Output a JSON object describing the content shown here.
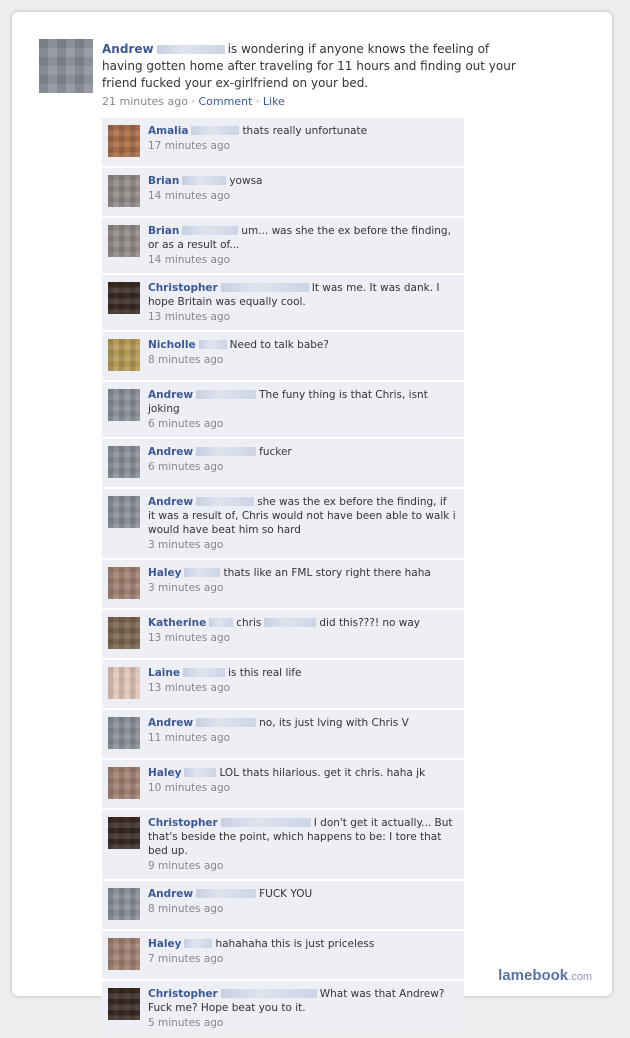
{
  "post": {
    "author": "Andrew",
    "text": "is wondering if anyone knows the feeling of having gotten home after traveling for 11 hours and finding out your friend fucked your ex-girlfriend on your bed.",
    "time": "21 minutes ago",
    "separator": "·",
    "comment_label": "Comment",
    "like_label": "Like",
    "avatar_color": "#8a8f99"
  },
  "comments": [
    {
      "name": "Amalia",
      "text": "thats really unfortunate",
      "time": "17 minutes ago",
      "avatar": "#a86b45"
    },
    {
      "name": "Brian",
      "text": "yowsa",
      "time": "14 minutes ago",
      "avatar": "#8f8a86"
    },
    {
      "name": "Brian",
      "text": "um... was she the ex before the finding, or as a result of...",
      "time": "14 minutes ago",
      "avatar": "#8f8a86"
    },
    {
      "name": "Christopher",
      "text": "It was me. It was dank. I hope Britain was equally cool.",
      "time": "13 minutes ago",
      "avatar": "#3a2b22"
    },
    {
      "name": "Nicholle",
      "text": "Need to talk babe?",
      "time": "8 minutes ago",
      "avatar": "#b59a55"
    },
    {
      "name": "Andrew",
      "text": "The funy thing is that Chris, isnt joking",
      "time": "6 minutes ago",
      "avatar": "#8a8f99"
    },
    {
      "name": "Andrew",
      "text": "fucker",
      "time": "6 minutes ago",
      "avatar": "#8a8f99"
    },
    {
      "name": "Andrew",
      "text": "she was the ex before the finding, if it was a result of, Chris would not have been able to walk i would have beat him so hard",
      "time": "3 minutes ago",
      "avatar": "#8a8f99"
    },
    {
      "name": "Haley",
      "text": "thats like an FML story right there haha",
      "time": "3 minutes ago",
      "avatar": "#a08070"
    },
    {
      "name": "Katherine",
      "text": "did this???! no way",
      "mention": "chris",
      "time": "13 minutes ago",
      "avatar": "#7a6550"
    },
    {
      "name": "Laine",
      "text": "is this real life",
      "time": "13 minutes ago",
      "avatar": "#e2c6b8"
    },
    {
      "name": "Andrew",
      "text": "no, its just lving with Chris V",
      "time": "11 minutes ago",
      "avatar": "#8a8f99"
    },
    {
      "name": "Haley",
      "text": "LOL thats hilarious. get it chris. haha jk",
      "time": "10 minutes ago",
      "avatar": "#a08070"
    },
    {
      "name": "Christopher",
      "text": "I don't get it actually... But that's beside the point, which happens to be: I tore that bed up.",
      "time": "9 minutes ago",
      "avatar": "#3a2b22"
    },
    {
      "name": "Andrew",
      "text": "FUCK YOU",
      "time": "8 minutes ago",
      "avatar": "#8a8f99"
    },
    {
      "name": "Haley",
      "text": "hahahaha this is just priceless",
      "time": "7 minutes ago",
      "avatar": "#a08070"
    },
    {
      "name": "Christopher",
      "text": "What was that Andrew? Fuck me? Hope beat you to it.",
      "time": "5 minutes ago",
      "avatar": "#3a2b22"
    }
  ],
  "brand": {
    "main": "lamebook",
    "suffix": ".com"
  }
}
